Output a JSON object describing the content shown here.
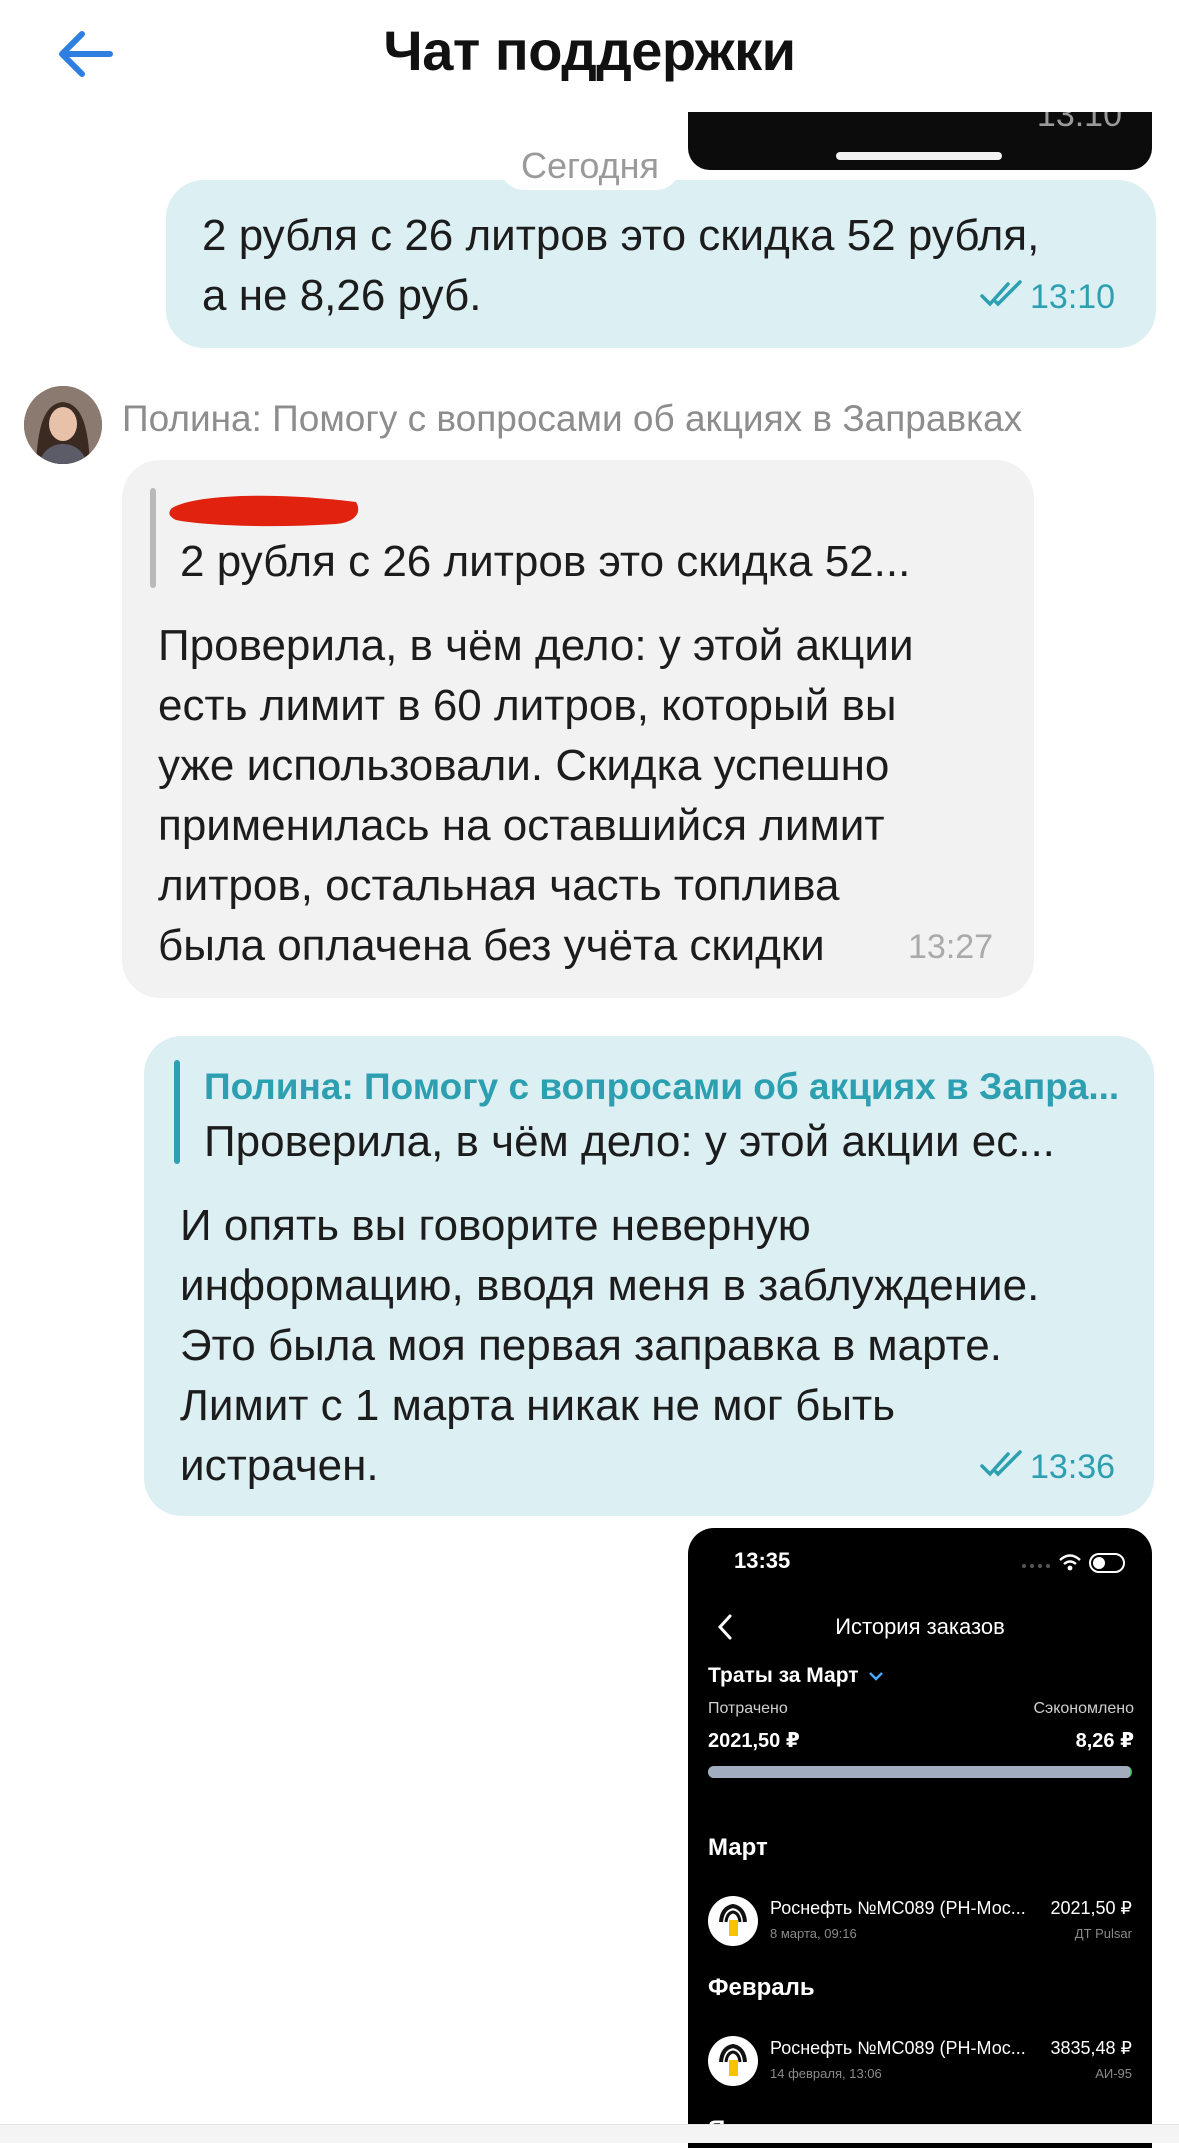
{
  "header": {
    "title": "Чат поддержки"
  },
  "top_fragment": {
    "time_partial": "13:10"
  },
  "date_divider": "Сегодня",
  "messages": [
    {
      "line1": "2 рубля с 26 литров это скидка 52 рубля,",
      "line2": "а не 8,26 руб.",
      "time": "13:10"
    },
    {
      "sender": "Полина: Помогу с вопросами об акциях в Заправках",
      "quote_text": "2 рубля с 26 литров это скидка 52...",
      "lines": [
        "Проверила, в чём дело: у этой акции",
        "есть лимит в 60 литров, который вы",
        "уже использовали. Скидка успешно",
        "применилась на оставшийся лимит",
        "литров, остальная часть топлива",
        "была оплачена без учёта скидки"
      ],
      "time": "13:27"
    },
    {
      "quote_author": "Полина: Помогу с вопросами об акциях в Запра...",
      "quote_text": "Проверила, в чём дело: у этой акции ес...",
      "lines": [
        "И опять вы говорите неверную",
        "информацию, вводя меня в заблуждение.",
        "Это была моя первая заправка в марте.",
        "Лимит с 1 марта никак не мог быть",
        "истрачен."
      ],
      "time": "13:36"
    }
  ],
  "screenshot": {
    "status_time": "13:35",
    "title": "История заказов",
    "period": "Траты за Март",
    "spent_label": "Потрачено",
    "spent_value": "2021,50 ₽",
    "saved_label": "Сэкономлено",
    "saved_value": "8,26 ₽",
    "progress_fraction": 0.996,
    "months": [
      {
        "name": "Март",
        "station": "Роснефть №МС089 (РН-Мос...",
        "date": "8 марта, 09:16",
        "amount": "2021,50 ₽",
        "fuel": "ДТ Pulsar"
      },
      {
        "name": "Февраль",
        "station": "Роснефть №МС089 (РН-Мос...",
        "date": "14 февраля, 13:06",
        "amount": "3835,48 ₽",
        "fuel": "АИ-95"
      }
    ],
    "next_month": "Январь"
  },
  "colors": {
    "accent": "#2c9fb1",
    "back_arrow": "#2f7fe0",
    "bubble_out": "#dceff3",
    "bubble_in": "#f2f2f2",
    "redaction": "#e0220e"
  }
}
